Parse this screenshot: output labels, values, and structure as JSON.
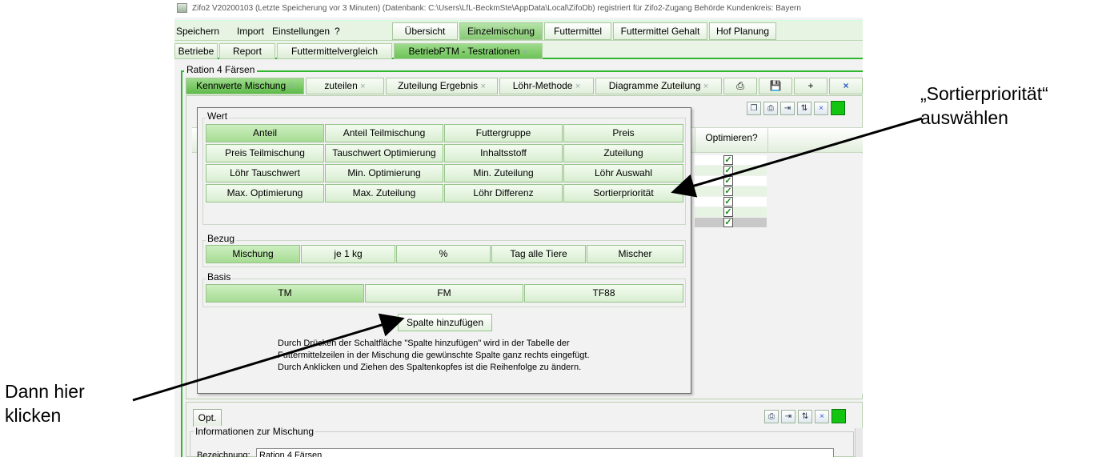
{
  "title_bar": {
    "text": "Zifo2 V20200103   (Letzte Speicherung vor 3 Minuten)   (Datenbank: C:\\Users\\LfL-BeckmSte\\AppData\\Local\\ZifoDb)   registriert für  Zifo2-Zugang Behörde   Kundenkreis:  Bayern"
  },
  "menu": {
    "items": [
      "Speichern",
      "Import",
      "Einstellungen",
      "?"
    ],
    "buttons": [
      "Übersicht",
      "Einzelmischung",
      "Futtermittel",
      "Futtermittel Gehalt",
      "Hof Planung"
    ]
  },
  "tabs": [
    "Betriebe",
    "Report",
    "Futtermittelvergleich",
    "BetriebPTM - Testrationen"
  ],
  "ration_label": "Ration 4 Färsen",
  "subtabs": [
    "Kennwerte Mischung",
    "zuteilen",
    "Zuteilung Ergebnis",
    "Löhr-Methode",
    "Diagramme Zuteilung"
  ],
  "subtab_plus": "+",
  "close_glyph": "×",
  "grid": {
    "optimize_header": "Optimieren?",
    "checks": [
      "✓",
      "✓",
      "✓",
      "✓",
      "✓",
      "✓",
      "✓"
    ]
  },
  "popup": {
    "wert_label": "Wert",
    "wert_buttons": [
      [
        "Anteil",
        "Anteil Teilmischung",
        "Futtergruppe",
        "Preis"
      ],
      [
        "Preis Teilmischung",
        "Tauschwert Optimierung",
        "Inhaltsstoff",
        "Zuteilung"
      ],
      [
        "Löhr Tauschwert",
        "Min. Optimierung",
        "Min. Zuteilung",
        "Löhr Auswahl"
      ],
      [
        "Max. Optimierung",
        "Max. Zuteilung",
        "Löhr Differenz",
        "Sortierpriorität"
      ]
    ],
    "bezug_label": "Bezug",
    "bezug_buttons": [
      "Mischung",
      "je 1 kg",
      "%",
      "Tag alle Tiere",
      "Mischer"
    ],
    "basis_label": "Basis",
    "basis_buttons": [
      "TM",
      "FM",
      "TF88"
    ],
    "add_button": "Spalte hinzufügen",
    "description": [
      "Durch Drücken der Schaltfläche \"Spalte hinzufügen\" wird in der Tabelle der",
      "Futtermittelzeilen in der Mischung die gewünschte Spalte ganz rechts eingefügt.",
      "Durch Anklicken und Ziehen des Spaltenkopfes ist die Reihenfolge zu ändern."
    ]
  },
  "lower": {
    "opt_button": "Opt.",
    "info_label": "Informationen zur Mischung",
    "bezeichnung_label": "Bezeichnung:",
    "bezeichnung_value": "Ration 4 Färsen"
  },
  "annotations": {
    "right": [
      "„Sortierpriorität“",
      "auswählen"
    ],
    "left": [
      "Dann hier",
      "klicken"
    ]
  },
  "colors": {
    "accent_green": "#2fb82f",
    "status_green": "#13c413"
  }
}
